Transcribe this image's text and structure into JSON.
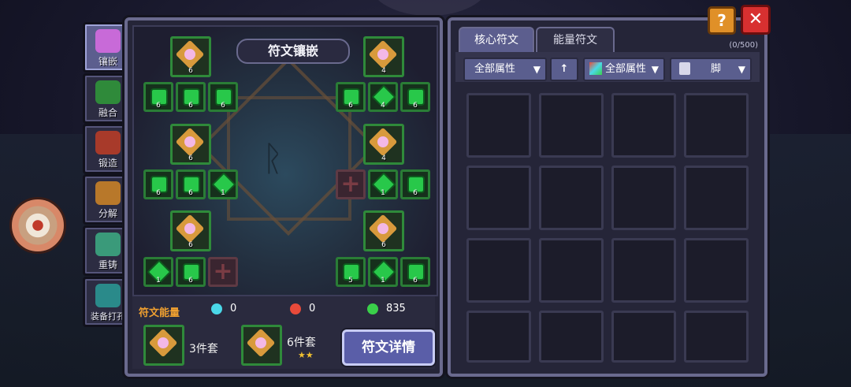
{
  "side_tabs": [
    {
      "label": "镶嵌",
      "icon": "inlay-icon",
      "active": true
    },
    {
      "label": "融合",
      "icon": "fusion-icon",
      "active": false
    },
    {
      "label": "锻造",
      "icon": "forge-icon",
      "active": false
    },
    {
      "label": "分解",
      "icon": "decompose-icon",
      "active": false
    },
    {
      "label": "重铸",
      "icon": "recast-icon",
      "active": false
    },
    {
      "label": "装备打孔",
      "icon": "punch-hole-icon",
      "active": false
    }
  ],
  "left_panel": {
    "title": "符文镶嵌",
    "slot_numbers": {
      "big_left": [
        "6",
        "6",
        "6"
      ],
      "big_right": [
        "4",
        "4",
        "6"
      ],
      "row1_left": [
        "6",
        "6",
        "6"
      ],
      "row1_right": [
        "6",
        "4",
        "6"
      ],
      "row2_left": [
        "6",
        "6",
        "1"
      ],
      "row2_right": [
        "1",
        "6"
      ],
      "row3_left": [
        "1",
        "6"
      ],
      "row3_right": [
        "5",
        "1",
        "6"
      ]
    },
    "energy": {
      "label": "符文能量",
      "blue": "0",
      "red": "0",
      "green": "835"
    },
    "sets": [
      {
        "label": "3件套"
      },
      {
        "label": "6件套",
        "stars": "★★"
      }
    ],
    "detail_button": "符文详情"
  },
  "right_panel": {
    "tabs": [
      {
        "label": "核心符文",
        "active": true
      },
      {
        "label": "能量符文",
        "active": false
      }
    ],
    "count": "(0/500)",
    "filters": {
      "attr1": "全部属性",
      "sort_icon": "up-arrow-icon",
      "attr2": "全部属性",
      "slot": "脚"
    }
  },
  "buttons": {
    "help": "?",
    "close": "✕"
  },
  "colors": {
    "accent": "#5c5e8e",
    "rune_frame": "#2f8a3a",
    "energy_label": "#f0a030"
  }
}
